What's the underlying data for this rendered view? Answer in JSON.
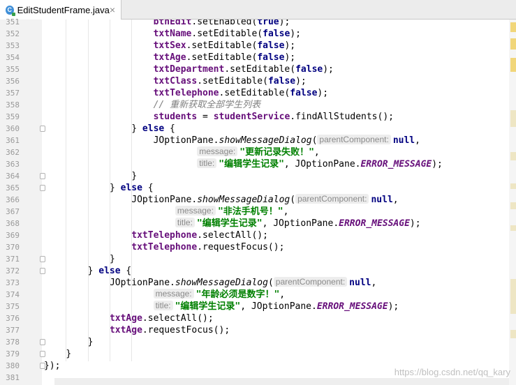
{
  "tab": {
    "file_name": "EditStudentFrame.java",
    "icon": "java-class-icon",
    "close": "×"
  },
  "watermark": "https://blog.csdn.net/qq_kary",
  "colors": {
    "field": "#660e7a",
    "keyword": "#000080",
    "string": "#008000",
    "comment": "#808080",
    "current_line": "#fffae3"
  },
  "lines": [
    {
      "n": "351",
      "indent": 20,
      "tokens": [
        [
          "f",
          "btnEdit"
        ],
        [
          "",
          "."
        ],
        [
          "",
          "setEnabled("
        ],
        [
          "k",
          "true"
        ],
        [
          "",
          ");"
        ]
      ]
    },
    {
      "n": "352",
      "indent": 20,
      "tokens": [
        [
          "f",
          "txtName"
        ],
        [
          "",
          ".setEditable("
        ],
        [
          "k",
          "false"
        ],
        [
          "",
          ");"
        ]
      ]
    },
    {
      "n": "353",
      "indent": 20,
      "tokens": [
        [
          "f",
          "txtSex"
        ],
        [
          "",
          ".setEditable("
        ],
        [
          "k",
          "false"
        ],
        [
          "",
          ");"
        ]
      ]
    },
    {
      "n": "354",
      "indent": 20,
      "tokens": [
        [
          "f",
          "txtAge"
        ],
        [
          "",
          ".setEditable("
        ],
        [
          "k",
          "false"
        ],
        [
          "",
          ");"
        ]
      ]
    },
    {
      "n": "355",
      "indent": 20,
      "tokens": [
        [
          "f",
          "txtDepartment"
        ],
        [
          "",
          ".setEditable("
        ],
        [
          "k",
          "false"
        ],
        [
          "",
          ");"
        ]
      ]
    },
    {
      "n": "356",
      "indent": 20,
      "tokens": [
        [
          "f",
          "txtClass"
        ],
        [
          "",
          ".setEditable("
        ],
        [
          "k",
          "false"
        ],
        [
          "",
          ");"
        ]
      ]
    },
    {
      "n": "357",
      "indent": 20,
      "tokens": [
        [
          "f",
          "txtTelephone"
        ],
        [
          "",
          ".setEditable("
        ],
        [
          "k",
          "false"
        ],
        [
          "",
          ");"
        ]
      ]
    },
    {
      "n": "358",
      "indent": 20,
      "tokens": [
        [
          "c",
          "// 重新获取全部学生列表"
        ]
      ]
    },
    {
      "n": "359",
      "indent": 20,
      "tokens": [
        [
          "f",
          "students"
        ],
        [
          "",
          " = "
        ],
        [
          "f",
          "studentService"
        ],
        [
          "",
          ".findAllStudents();"
        ]
      ]
    },
    {
      "n": "360",
      "indent": 16,
      "fold": true,
      "tokens": [
        [
          "",
          "} "
        ],
        [
          "k",
          "else"
        ],
        [
          "",
          " {"
        ]
      ]
    },
    {
      "n": "361",
      "indent": 20,
      "tokens": [
        [
          "",
          "JOptionPane."
        ],
        [
          "st",
          "showMessageDialog"
        ],
        [
          "",
          "("
        ],
        [
          "h",
          "parentComponent:"
        ],
        [
          "k",
          "null"
        ],
        [
          "",
          ","
        ]
      ]
    },
    {
      "n": "362",
      "indent": 28,
      "tokens": [
        [
          "h",
          "message:"
        ],
        [
          "s",
          "\"更新记录失败！\""
        ],
        [
          "",
          ","
        ]
      ]
    },
    {
      "n": "363",
      "indent": 28,
      "tokens": [
        [
          "h",
          "title:"
        ],
        [
          "s",
          "\"编辑学生记录\""
        ],
        [
          "",
          ", JOptionPane."
        ],
        [
          "sf",
          "ERROR_MESSAGE"
        ],
        [
          "",
          ");"
        ]
      ]
    },
    {
      "n": "364",
      "indent": 16,
      "fold": true,
      "tokens": [
        [
          "",
          "}"
        ]
      ]
    },
    {
      "n": "365",
      "indent": 12,
      "fold": true,
      "tokens": [
        [
          "",
          "} "
        ],
        [
          "k",
          "else"
        ],
        [
          "",
          " {"
        ]
      ]
    },
    {
      "n": "366",
      "indent": 16,
      "tokens": [
        [
          "",
          "JOptionPane."
        ],
        [
          "st",
          "showMessageDialog"
        ],
        [
          "",
          "("
        ],
        [
          "h",
          "parentComponent:"
        ],
        [
          "k",
          "null"
        ],
        [
          "",
          ","
        ]
      ]
    },
    {
      "n": "367",
      "indent": 24,
      "tokens": [
        [
          "h",
          "message:"
        ],
        [
          "s",
          "\"非法手机号！\""
        ],
        [
          "",
          ","
        ]
      ]
    },
    {
      "n": "368",
      "indent": 24,
      "tokens": [
        [
          "h",
          "title:"
        ],
        [
          "s",
          "\"编辑学生记录\""
        ],
        [
          "",
          ", JOptionPane."
        ],
        [
          "sf",
          "ERROR_MESSAGE"
        ],
        [
          "",
          ");"
        ]
      ]
    },
    {
      "n": "369",
      "indent": 16,
      "tokens": [
        [
          "f",
          "txtTelephone"
        ],
        [
          "",
          ".selectAll();"
        ]
      ]
    },
    {
      "n": "370",
      "indent": 16,
      "current": true,
      "tokens": [
        [
          "f",
          "txtTelephone"
        ],
        [
          "",
          ".requestFocus();"
        ]
      ]
    },
    {
      "n": "371",
      "indent": 12,
      "fold": true,
      "tokens": [
        [
          "",
          "}"
        ]
      ]
    },
    {
      "n": "372",
      "indent": 8,
      "fold": true,
      "tokens": [
        [
          "",
          "} "
        ],
        [
          "k",
          "else"
        ],
        [
          "",
          " {"
        ]
      ]
    },
    {
      "n": "373",
      "indent": 12,
      "tokens": [
        [
          "",
          "JOptionPane."
        ],
        [
          "st",
          "showMessageDialog"
        ],
        [
          "",
          "("
        ],
        [
          "h",
          "parentComponent:"
        ],
        [
          "k",
          "null"
        ],
        [
          "",
          ","
        ]
      ]
    },
    {
      "n": "374",
      "indent": 20,
      "tokens": [
        [
          "h",
          "message:"
        ],
        [
          "s",
          "\"年龄必须是数字！\""
        ],
        [
          "",
          ","
        ]
      ]
    },
    {
      "n": "375",
      "indent": 20,
      "tokens": [
        [
          "h",
          "title:"
        ],
        [
          "s",
          "\"编辑学生记录\""
        ],
        [
          "",
          ", JOptionPane."
        ],
        [
          "sf",
          "ERROR_MESSAGE"
        ],
        [
          "",
          ");"
        ]
      ]
    },
    {
      "n": "376",
      "indent": 12,
      "tokens": [
        [
          "f",
          "txtAge"
        ],
        [
          "",
          ".selectAll();"
        ]
      ]
    },
    {
      "n": "377",
      "indent": 12,
      "tokens": [
        [
          "f",
          "txtAge"
        ],
        [
          "",
          ".requestFocus();"
        ]
      ]
    },
    {
      "n": "378",
      "indent": 8,
      "fold": true,
      "tokens": [
        [
          "",
          "}"
        ]
      ]
    },
    {
      "n": "379",
      "indent": 4,
      "fold": true,
      "tokens": [
        [
          "",
          "}"
        ]
      ]
    },
    {
      "n": "380",
      "indent": 0,
      "fold": true,
      "tokens": [
        [
          "",
          "});"
        ]
      ]
    },
    {
      "n": "381",
      "indent": 0,
      "tokens": []
    }
  ]
}
